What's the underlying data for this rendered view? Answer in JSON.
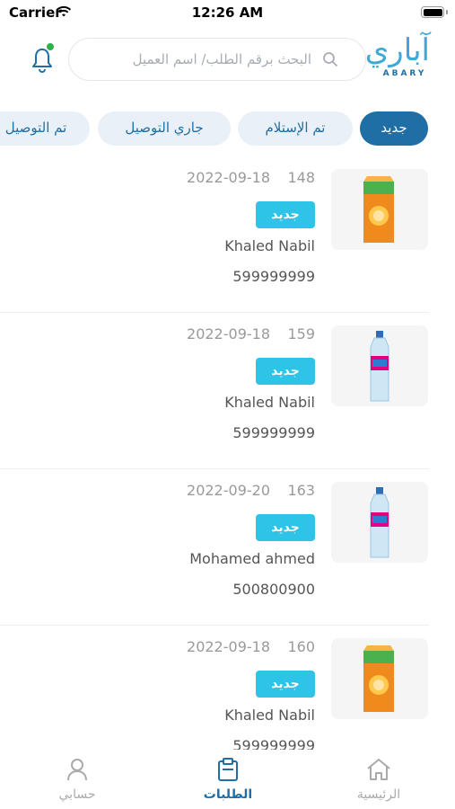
{
  "status_bar": {
    "carrier": "Carrier",
    "time": "12:26 AM"
  },
  "header": {
    "search_placeholder": "البحث برقم الطلب/ اسم العميل",
    "logo_ar": "آباري",
    "logo_en": "ABARY",
    "notification_dot_color": "#2fb24c"
  },
  "tabs": [
    {
      "label": "جديد",
      "active": true
    },
    {
      "label": "تم الإستلام",
      "active": false
    },
    {
      "label": "جاري التوصيل",
      "active": false
    },
    {
      "label": "تم التوصيل",
      "active": false
    }
  ],
  "orders": [
    {
      "id": "148",
      "date": "2022-09-18",
      "status": "جديد",
      "customer": "Khaled Nabil",
      "phone": "599999999",
      "product_icon": "juice-carton-icon"
    },
    {
      "id": "159",
      "date": "2022-09-18",
      "status": "جديد",
      "customer": "Khaled Nabil",
      "phone": "599999999",
      "product_icon": "water-bottle-icon"
    },
    {
      "id": "163",
      "date": "2022-09-20",
      "status": "جديد",
      "customer": "Mohamed ahmed",
      "phone": "500800900",
      "product_icon": "water-bottle-icon"
    },
    {
      "id": "160",
      "date": "2022-09-18",
      "status": "جديد",
      "customer": "Khaled Nabil",
      "phone": "599999999",
      "product_icon": "juice-carton-icon"
    }
  ],
  "bottom_nav": {
    "home": "الرئيسية",
    "orders": "الطلبات",
    "account": "حسابي",
    "active": "orders"
  },
  "colors": {
    "primary": "#1f6fa6",
    "badge": "#2ec4e8",
    "tab_bg": "#e9f0f7"
  }
}
